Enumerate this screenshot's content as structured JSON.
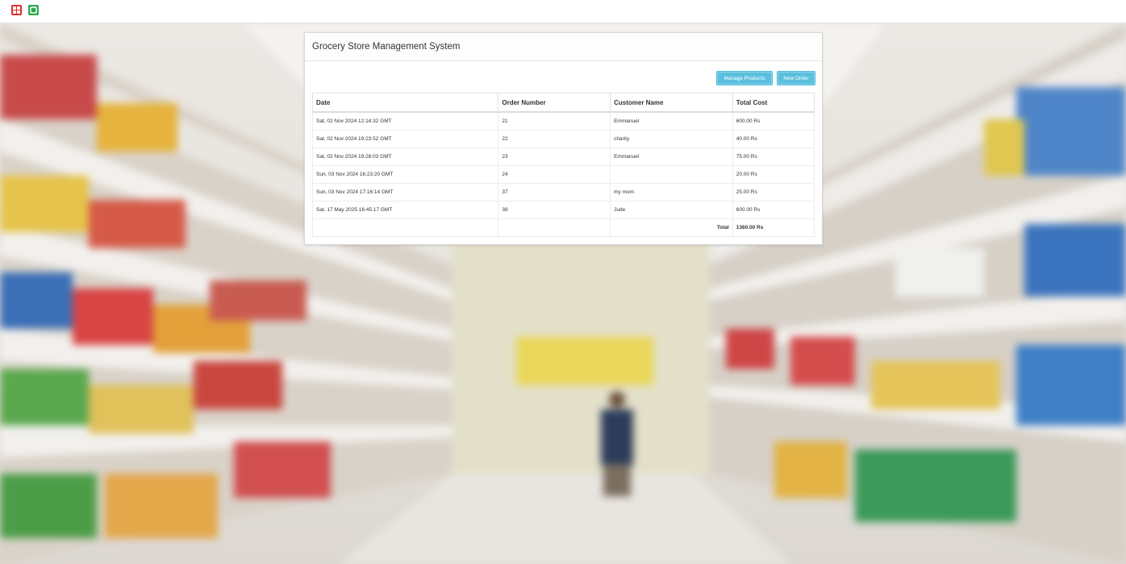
{
  "taskbar": {
    "icons": [
      "app-grid-icon",
      "app-green-icon"
    ],
    "colors": {
      "red": "#d9302b",
      "green": "#2fa84f"
    }
  },
  "panel": {
    "title": "Grocery Store Management System"
  },
  "actions": {
    "manage_products": "Manage Products",
    "new_order": "New Order"
  },
  "table": {
    "headers": [
      "Date",
      "Order Number",
      "Customer Name",
      "Total Cost"
    ],
    "rows": [
      {
        "date": "Sat, 02 Nov 2024 12:14:32 GMT",
        "order": "21",
        "customer": "Emmanuel",
        "cost": "600.00 Rs"
      },
      {
        "date": "Sat, 02 Nov 2024 19:23:52 GMT",
        "order": "22",
        "customer": "charity",
        "cost": "40.00 Rs"
      },
      {
        "date": "Sat, 02 Nov 2024 19:28:03 GMT",
        "order": "23",
        "customer": "Emmanuel",
        "cost": "75.00 Rs"
      },
      {
        "date": "Sun, 03 Nov 2024 16:23:20 GMT",
        "order": "24",
        "customer": "",
        "cost": "20.00 Rs"
      },
      {
        "date": "Sun, 03 Nov 2024 17:16:14 GMT",
        "order": "37",
        "customer": "my mom",
        "cost": "25.00 Rs"
      },
      {
        "date": "Sat, 17 May 2025 16:45:17 GMT",
        "order": "38",
        "customer": "Jude",
        "cost": "600.00 Rs"
      }
    ],
    "total_label": "Total",
    "total_value": "1360.00 Rs"
  },
  "colors": {
    "button": "#5bc0de",
    "button_border": "#46b8da",
    "panel_border": "#d9d9d9"
  }
}
